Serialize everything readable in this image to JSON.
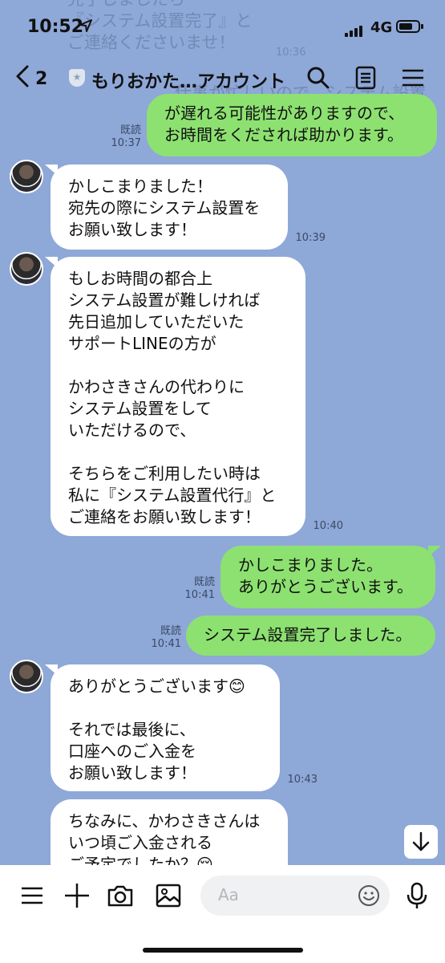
{
  "status": {
    "time": "10:52",
    "location_icon": "location-arrow-icon",
    "network": "4G"
  },
  "header": {
    "back_count": "2",
    "title": "もりおかた…アカウント"
  },
  "faded_text": {
    "top": "完了しましたら\n『システム設置完了』と\nご連絡くださいませ！",
    "top_time": "10:36",
    "mid": "仕事が忙しいので、システム設置"
  },
  "messages": [
    {
      "dir": "out",
      "text": "が遅れる可能性がありますので、\nお時間をくだされば助かります。",
      "read": "既読",
      "time": "10:37"
    },
    {
      "dir": "in",
      "text": "かしこまりました！\n宛先の際にシステム設置を\nお願い致します！",
      "time": "10:39"
    },
    {
      "dir": "in",
      "text": "もしお時間の都合上\nシステム設置が難しければ\n先日追加していただいた\nサポートLINEの方が\n\nかわさきさんの代わりに\nシステム設置をして\nいただけるので、\n\nそちらをご利用したい時は\n私に『システム設置代行』と\nご連絡をお願い致します！",
      "time": "10:40"
    },
    {
      "dir": "out",
      "text": "かしこまりました。\nありがとうございます。",
      "read": "既読",
      "time": "10:41"
    },
    {
      "dir": "out",
      "text": "システム設置完了しました。",
      "read": "既読",
      "time": "10:41"
    },
    {
      "dir": "in",
      "text": "ありがとうございます😊\n\nそれでは最後に、\n口座へのご入金を\nお願い致します！",
      "time": "10:43"
    },
    {
      "dir": "in",
      "text": "ちなみに、かわさきさんは\nいつ頃ご入金される\nご予定でしたか？😌",
      "time": ""
    }
  ],
  "input": {
    "placeholder": "Aa"
  },
  "colors": {
    "background": "#8ea8d8",
    "outgoing": "#8de171",
    "incoming": "#ffffff"
  }
}
